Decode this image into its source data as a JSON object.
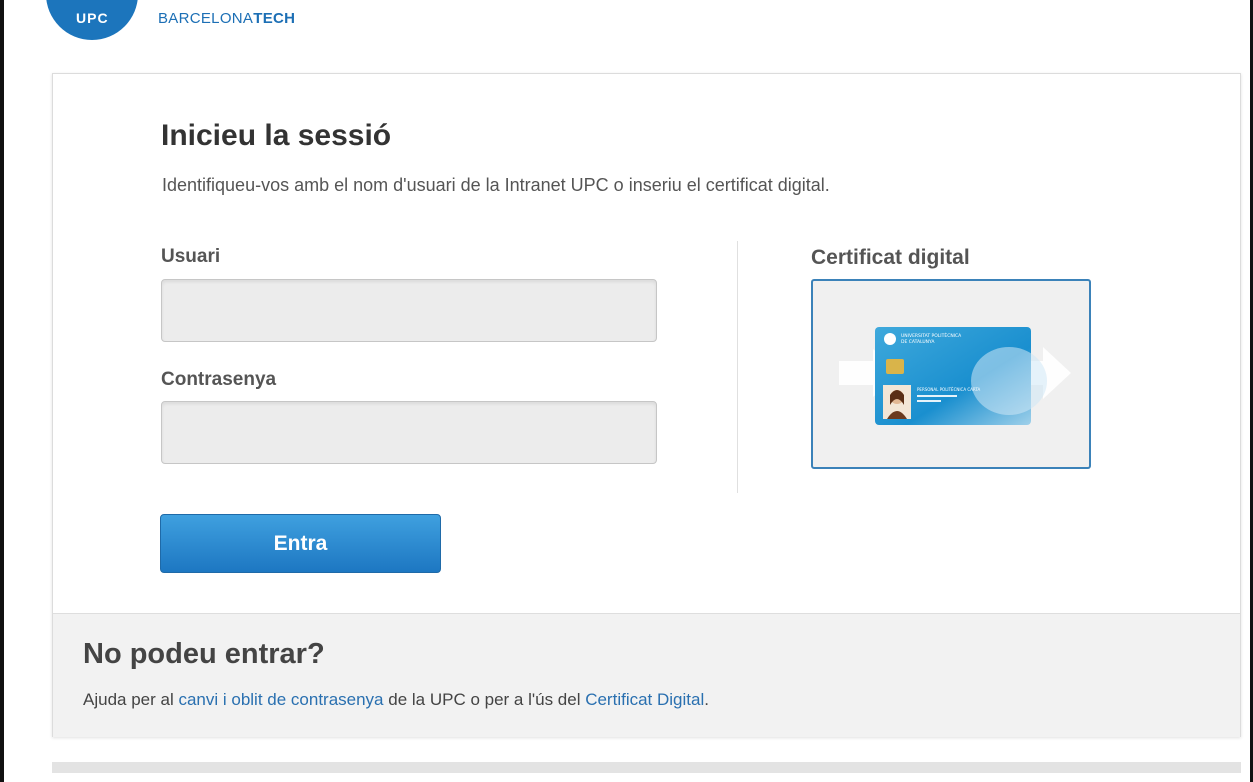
{
  "header": {
    "logo_abbr": "UPC",
    "logo_name_light": "BARCELONA",
    "logo_name_bold": "TECH"
  },
  "login": {
    "title": "Inicieu la sessió",
    "subtitle": "Identifiqueu-vos amb el nom d'usuari de la Intranet UPC o inseriu el certificat digital.",
    "username_label": "Usuari",
    "username_value": "",
    "password_label": "Contrasenya",
    "password_value": "",
    "submit_label": "Entra",
    "cert_label": "Certificat digital",
    "cert_card": {
      "university_line1": "UNIVERSITAT POLITÈCNICA",
      "university_line2": "DE CATALUNYA",
      "holder": "PERSONAL POLITÈCNICA CARTA"
    }
  },
  "help": {
    "title": "No podeu entrar?",
    "text_before": "Ajuda per al ",
    "link_password": "canvi i oblit de contrasenya",
    "text_middle": " de la UPC o per a l'ús del ",
    "link_cert": "Certificat Digital",
    "text_after": "."
  },
  "colors": {
    "brand_blue": "#1c75bc",
    "button_blue": "#2a86cf",
    "link_blue": "#2a70b0"
  }
}
